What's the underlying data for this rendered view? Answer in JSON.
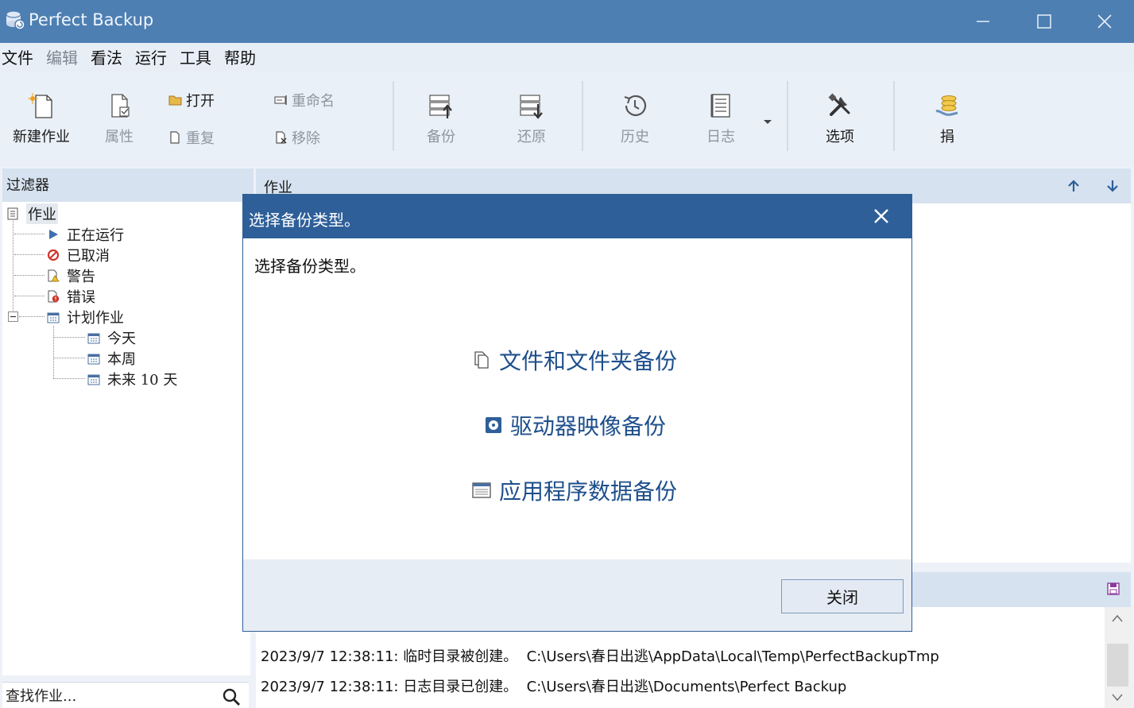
{
  "window": {
    "title": "Perfect Backup"
  },
  "menu": [
    "文件",
    "编辑",
    "看法",
    "运行",
    "工具",
    "帮助"
  ],
  "toolbar": {
    "new_job": "新建作业",
    "properties": "属性",
    "open": "打开",
    "repeat": "重复",
    "rename": "重命名",
    "remove": "移除",
    "backup": "备份",
    "restore": "还原",
    "history": "历史",
    "log": "日志",
    "options": "选项",
    "donate": "捐"
  },
  "filter": {
    "title": "过滤器",
    "tree": {
      "jobs": "作业",
      "running": "正在运行",
      "cancelled": "已取消",
      "warning": "警告",
      "error": "错误",
      "scheduled": "计划作业",
      "today": "今天",
      "this_week": "本周",
      "next_10_days": "未来 10 天"
    },
    "search_placeholder": "查找作业..."
  },
  "jobs_panel": {
    "title": "作业"
  },
  "log": [
    {
      "ts": "2023/9/7 12:38:11: ",
      "msg": "临时目录被创建。",
      "path": "C:\\Users\\春日出逃\\AppData\\Local\\Temp\\PerfectBackupTmp"
    },
    {
      "ts": "2023/9/7 12:38:11: ",
      "msg": "日志目录已创建。",
      "path": "C:\\Users\\春日出逃\\Documents\\Perfect Backup"
    }
  ],
  "dialog": {
    "title": "选择备份类型。",
    "prompt": "选择备份类型。",
    "options": [
      "文件和文件夹备份",
      "驱动器映像备份",
      "应用程序数据备份"
    ],
    "close_label": "关闭"
  },
  "colors": {
    "titlebar": "#4d7fb3",
    "dialog_titlebar": "#2e5f99",
    "link": "#1e4f8c",
    "panel_header": "#d6e2ef"
  }
}
